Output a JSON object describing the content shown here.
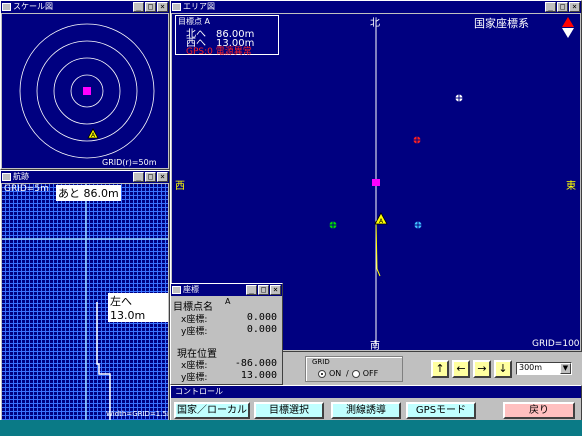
{
  "scale_window": {
    "title": "スケール図",
    "grid_label": "GRID(r)=50m",
    "ring_count": 4
  },
  "track_window": {
    "title": "航跡",
    "grid_label": "GRID=5m",
    "remaining_label": "あと 86.0m",
    "left_label": "左へ 13.0m",
    "bottom_label": "Width=GRID=1.5m"
  },
  "area_window": {
    "title": "エリア図",
    "coord_system": "国家座標系",
    "target_header": "目標点 A",
    "north_line": "北へ　86.00m",
    "west_line": "西へ　13.00m",
    "gps_status": "GPS:0 電源異常",
    "dir_north": "北",
    "dir_south": "南",
    "dir_east": "東",
    "dir_west": "西",
    "grid_label": "GRID=100m"
  },
  "coord_window": {
    "title": "座標",
    "target_name_label": "目標点名",
    "target_name_value": "A",
    "x_label": "x座標:",
    "x_value": "0.000",
    "y_label": "y座標:",
    "y_value": "0.000",
    "current_label": "現在位置",
    "cur_x_label": "x座標:",
    "cur_x_value": "-86.000",
    "cur_y_label": "y座標:",
    "cur_y_value": "13.000"
  },
  "grid_group": {
    "label": "GRID",
    "on_label": "ON",
    "off_label": "OFF",
    "selected": "ON"
  },
  "arrows": {
    "up": "↑",
    "left": "←",
    "right": "→",
    "down": "↓"
  },
  "scale_select": {
    "value": "300m"
  },
  "control_panel": {
    "title": "コントロール",
    "btn_coord": "国家／ローカル",
    "btn_target": "目標選択",
    "btn_guide": "測線誘導",
    "btn_gps": "GPSモード",
    "btn_back": "戻り"
  },
  "title_buttons": {
    "minimize": "_",
    "maximize": "□",
    "close": "×"
  },
  "colors": {
    "navy": "#000080",
    "magenta": "#ff00ff",
    "yellow": "#ffff00",
    "red": "#ff0000",
    "cyan_btn": "#c0ffff",
    "pink_btn": "#ffc0c0"
  }
}
